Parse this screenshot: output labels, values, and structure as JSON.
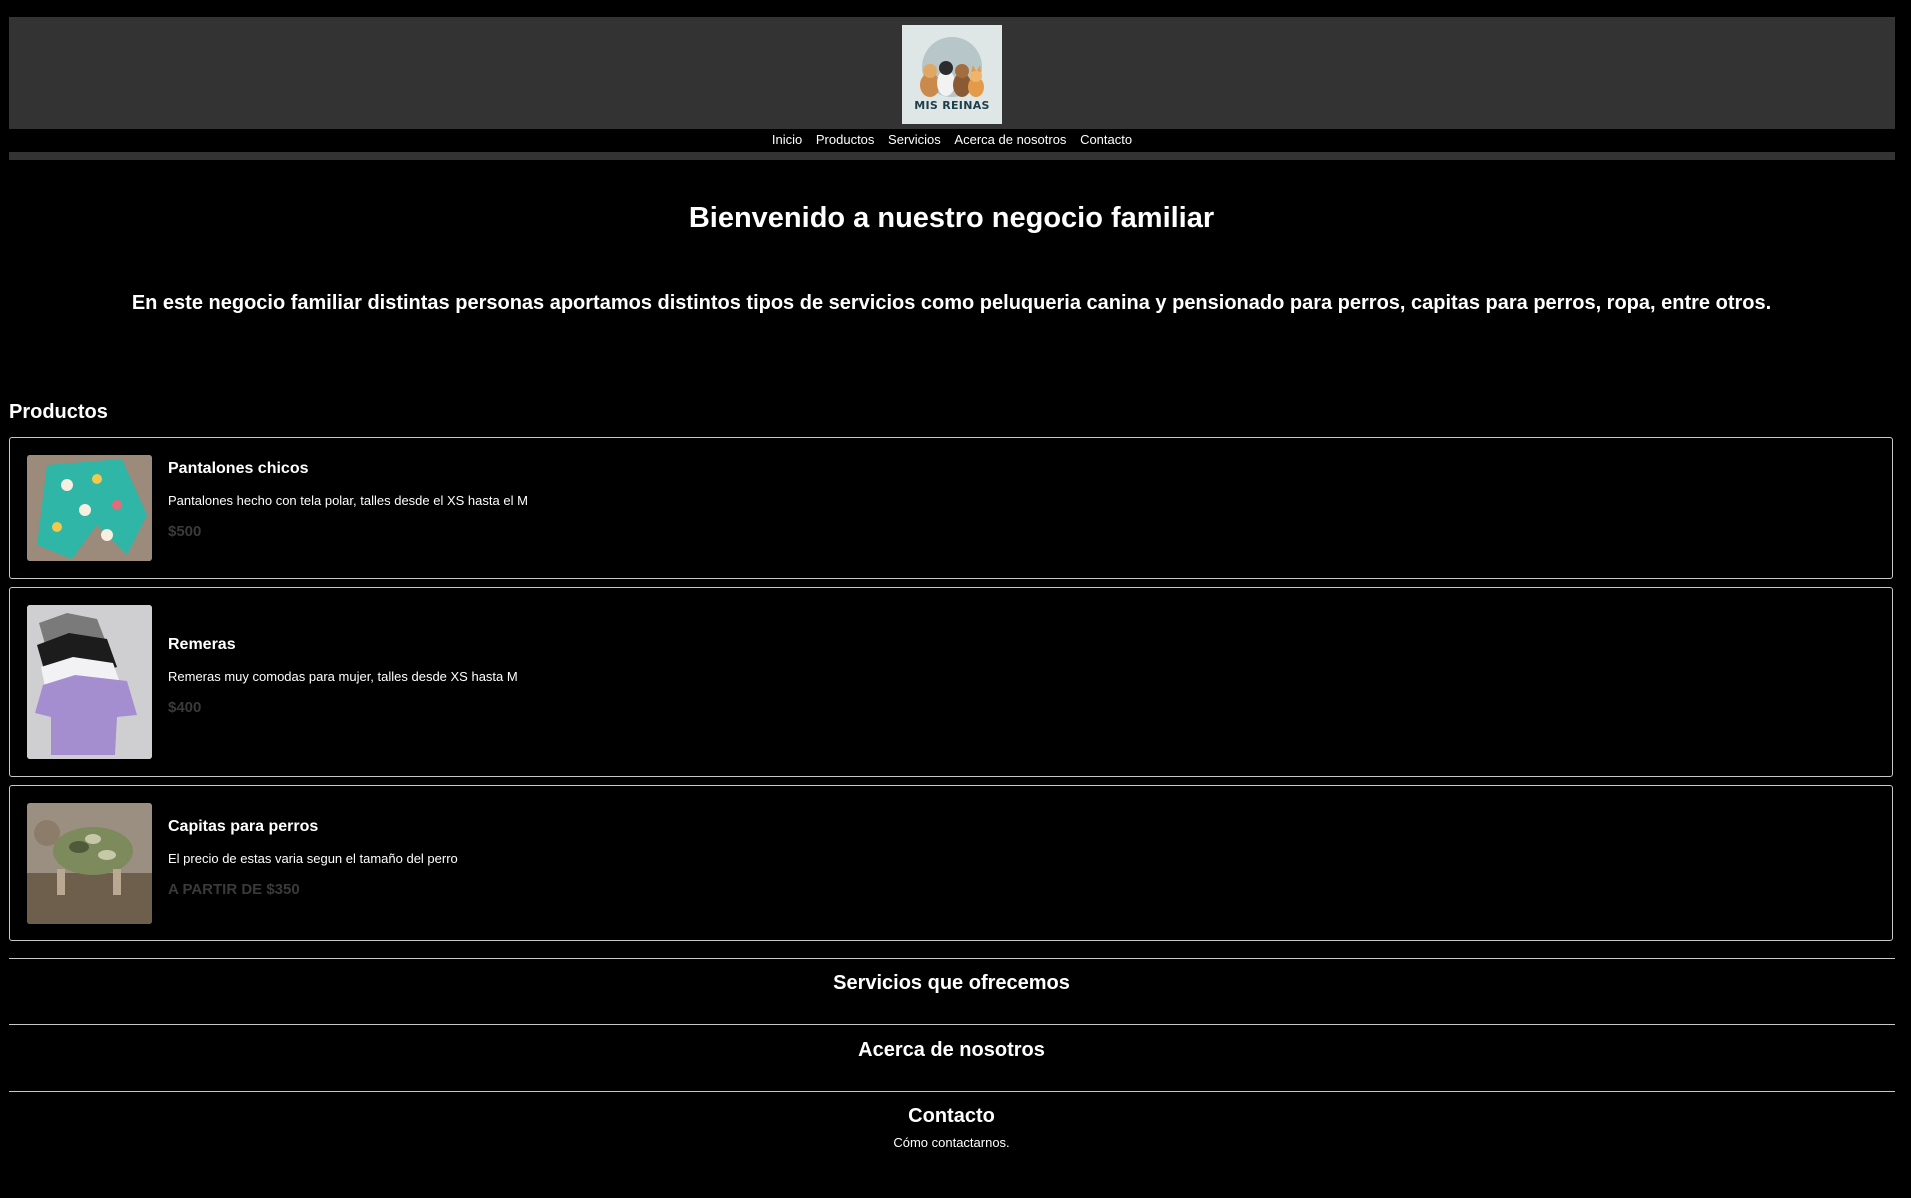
{
  "header": {
    "logo_text": "MIS REINAS"
  },
  "nav": {
    "items": [
      "Inicio",
      "Productos",
      "Servicios",
      "Acerca de nosotros",
      "Contacto"
    ]
  },
  "hero": {
    "title": "Bienvenido a nuestro negocio familiar",
    "text": "En este negocio familiar distintas personas aportamos distintos tipos de servicios como peluqueria canina y pensionado para perros, capitas para perros, ropa, entre otros."
  },
  "products": {
    "title": "Productos",
    "items": [
      {
        "name": "Pantalones chicos",
        "description": "Pantalones hecho con tela polar, talles desde el XS hasta el M",
        "price": "$500"
      },
      {
        "name": "Remeras",
        "description": "Remeras muy comodas para mujer, talles desde XS hasta M",
        "price": "$400"
      },
      {
        "name": "Capitas para perros",
        "description": "El precio de estas varia segun el tamaño del perro",
        "price": "A PARTIR DE $350"
      }
    ]
  },
  "sections": {
    "services_title": "Servicios que ofrecemos",
    "about_title": "Acerca de nosotros",
    "contact_title": "Contacto",
    "contact_sub": "Cómo contactarnos."
  },
  "colors": {
    "background": "#000000",
    "header_bg": "#333333",
    "text": "#ffffff",
    "price": "#3a3a3a",
    "border": "#c8c8c8"
  }
}
